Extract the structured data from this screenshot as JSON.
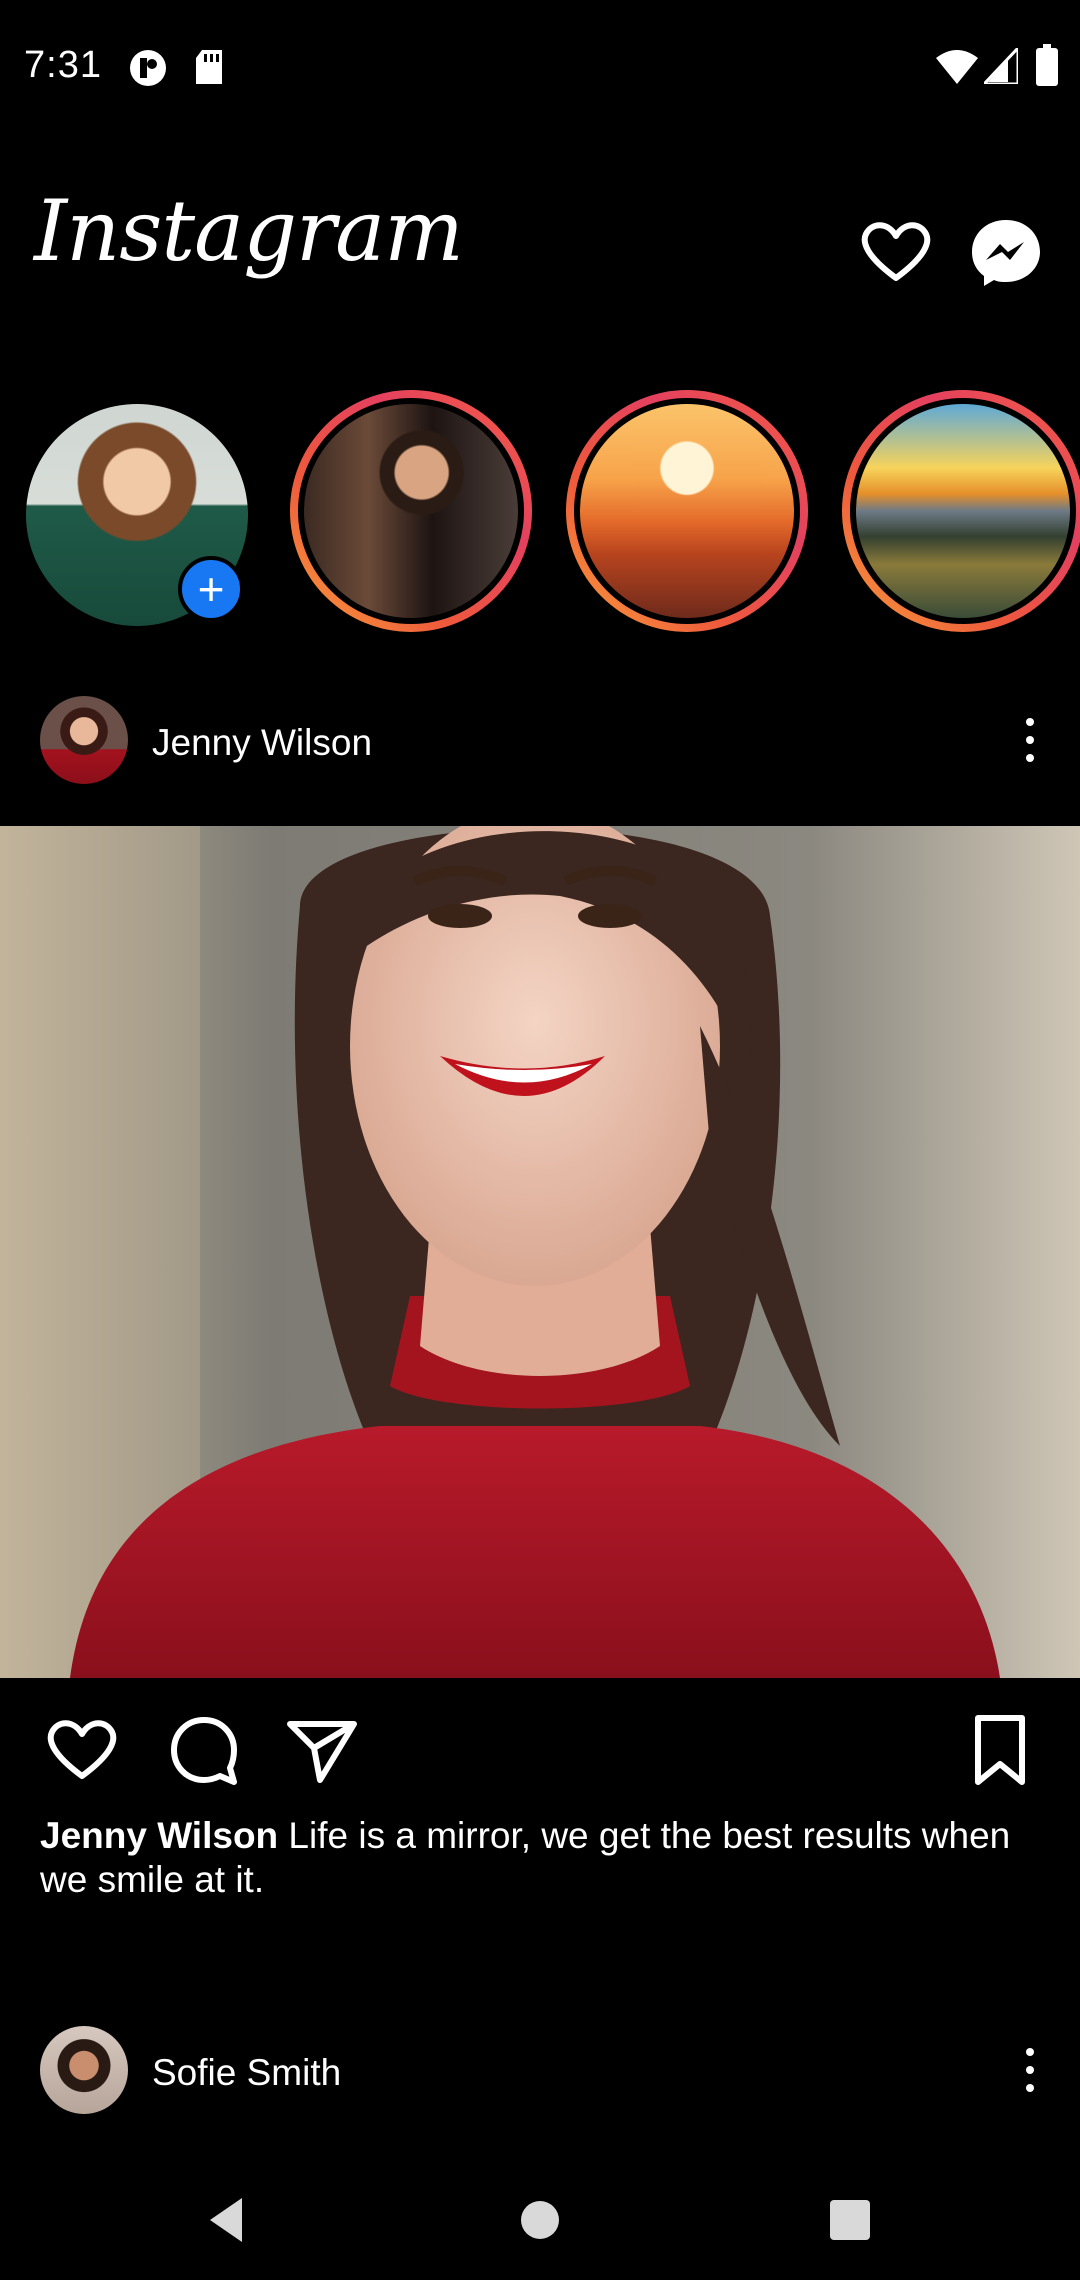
{
  "status_bar": {
    "time": "7:31",
    "icons": [
      "notification-icon",
      "sd-card-icon",
      "wifi-icon",
      "signal-icon",
      "battery-icon"
    ]
  },
  "header": {
    "logo": "Instagram",
    "icons": [
      "heart-icon",
      "messenger-icon"
    ]
  },
  "stories": {
    "items": [
      {
        "name": "your-story",
        "image": "woman-curly-hair-green-top",
        "add_icon": "+"
      },
      {
        "name": "story-man",
        "image": "man-leather-jacket"
      },
      {
        "name": "story-sunset",
        "image": "orange-mountain-sunset"
      },
      {
        "name": "story-lake",
        "image": "mountain-lake-sunrise"
      }
    ]
  },
  "posts": [
    {
      "username": "Jenny Wilson",
      "image": "woman-red-sweater-smiling",
      "caption_user": "Jenny Wilson",
      "caption_text": " Life is a mirror, we get the best results when we smile at it."
    },
    {
      "username": "Sofie Smith"
    }
  ],
  "actions": [
    "heart-icon",
    "comment-icon",
    "send-icon",
    "bookmark-icon"
  ],
  "nav": [
    "back-icon",
    "home-icon",
    "recents-icon"
  ],
  "colors": {
    "background": "#000000",
    "story_ring_start": "#f9a13a",
    "story_ring_end": "#e4405f",
    "add_badge": "#1877f2"
  }
}
